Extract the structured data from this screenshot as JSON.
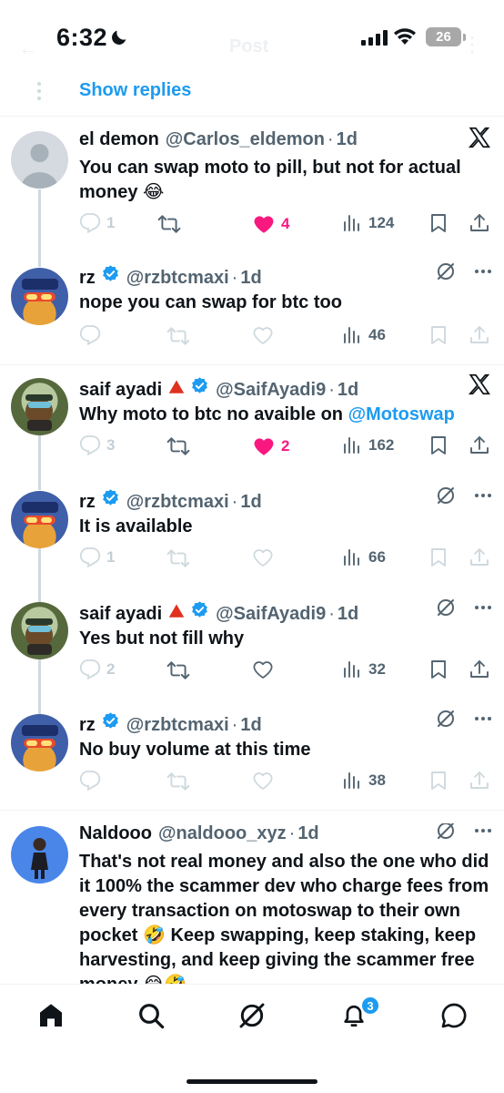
{
  "status_bar": {
    "time": "6:32",
    "battery": "26"
  },
  "header": {
    "title": "Post"
  },
  "thread": {
    "show_replies": "Show replies"
  },
  "tweets": [
    {
      "name": "el demon",
      "handle": "@Carlos_eldemon",
      "time": "1d",
      "text": "You can swap moto to pill, but not for actual money 😂",
      "replies": "1",
      "likes": "4",
      "views": "124",
      "liked": true
    },
    {
      "name": "rz",
      "handle": "@rzbtcmaxi",
      "time": "1d",
      "text": "nope you can swap for btc too",
      "replies": "",
      "likes": "",
      "views": "46"
    },
    {
      "name": "saif ayadi",
      "handle": "@SaifAyadi9",
      "time": "1d",
      "text": "Why moto to btc no avaible on ",
      "mention": "@Motoswap",
      "replies": "3",
      "likes": "2",
      "views": "162",
      "liked": true
    },
    {
      "name": "rz",
      "handle": "@rzbtcmaxi",
      "time": "1d",
      "text": "It is available",
      "replies": "1",
      "likes": "",
      "views": "66"
    },
    {
      "name": "saif ayadi",
      "handle": "@SaifAyadi9",
      "time": "1d",
      "text": "Yes but not fill why",
      "replies": "2",
      "likes": "",
      "views": "32"
    },
    {
      "name": "rz",
      "handle": "@rzbtcmaxi",
      "time": "1d",
      "text": "No buy volume at this time",
      "replies": "",
      "likes": "",
      "views": "38"
    },
    {
      "name": "Naldooo",
      "handle": "@naldooo_xyz",
      "time": "1d",
      "text": "That's not real money and also the one who did it 100% the scammer dev who charge fees from every transaction on motoswap to their own pocket 🤣 Keep swapping, keep staking, keep harvesting, and keep giving the scammer free money 😂🤣"
    }
  ],
  "nav": {
    "notifications_count": "3"
  },
  "colors": {
    "accent": "#1d9bf0",
    "like": "#f91880",
    "text": "#0f1419",
    "muted": "#536471"
  }
}
